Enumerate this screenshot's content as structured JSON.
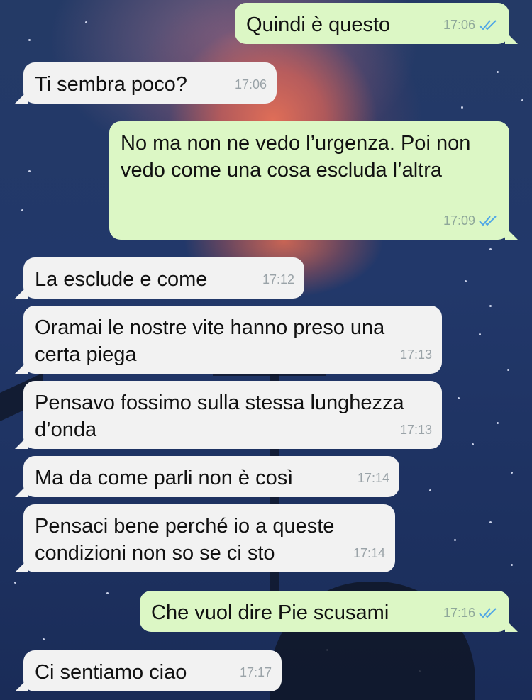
{
  "colors": {
    "incoming_bubble": "#f2f2f2",
    "outgoing_bubble": "#dcf7c5",
    "read_ticks": "#4fa6e6",
    "timestamp": "#9aa3a8"
  },
  "icons": {
    "read_receipt": "double-check-icon"
  },
  "messages": [
    {
      "direction": "outgoing",
      "text": "Quindi è questo",
      "time": "17:06",
      "read": true
    },
    {
      "direction": "incoming",
      "text": "Ti sembra poco?",
      "time": "17:06"
    },
    {
      "direction": "outgoing",
      "text": "No ma non ne vedo l’urgenza. Poi non vedo come una cosa escluda l’altra",
      "time": "17:09",
      "read": true
    },
    {
      "direction": "incoming",
      "text": "La esclude e come",
      "time": "17:12"
    },
    {
      "direction": "incoming",
      "text": "Oramai le nostre vite hanno preso una certa piega",
      "time": "17:13"
    },
    {
      "direction": "incoming",
      "text": "Pensavo fossimo sulla stessa lunghezza d’onda",
      "time": "17:13"
    },
    {
      "direction": "incoming",
      "text": "Ma da come parli non è così",
      "time": "17:14"
    },
    {
      "direction": "incoming",
      "text": "Pensaci bene perché io a queste condizioni non so se ci sto",
      "time": "17:14"
    },
    {
      "direction": "outgoing",
      "text": "Che vuol dire Pie scusami",
      "time": "17:16",
      "read": true
    },
    {
      "direction": "incoming",
      "text": "Ci sentiamo ciao",
      "time": "17:17"
    }
  ]
}
